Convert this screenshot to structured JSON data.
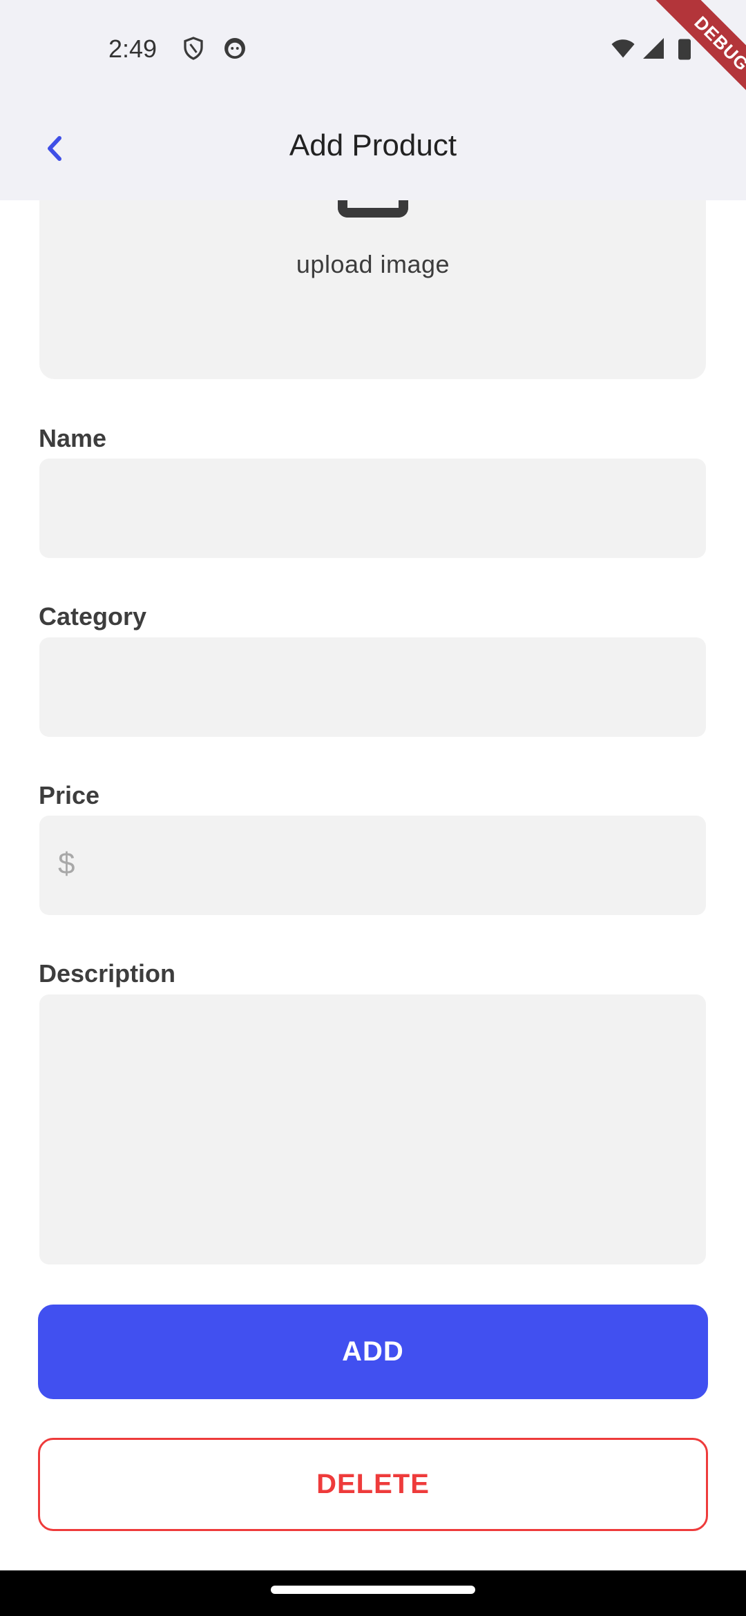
{
  "status_bar": {
    "time": "2:49",
    "icons": [
      "shield-icon",
      "face-icon",
      "wifi-icon",
      "signal-icon",
      "battery-icon"
    ]
  },
  "app_bar": {
    "title": "Add Product",
    "back_icon": "chevron-left-icon"
  },
  "debug_banner": "DEBUG",
  "upload": {
    "label": "upload image",
    "icon": "upload-icon"
  },
  "form": {
    "name": {
      "label": "Name",
      "value": ""
    },
    "category": {
      "label": "Category",
      "value": ""
    },
    "price": {
      "label": "Price",
      "prefix": "$",
      "value": ""
    },
    "description": {
      "label": "Description",
      "value": ""
    }
  },
  "actions": {
    "add_label": "ADD",
    "delete_label": "DELETE"
  },
  "colors": {
    "primary": "#4150f0",
    "danger": "#ee3b3b",
    "field_bg": "#f2f2f2",
    "app_bar_bg": "#f1f1f6"
  }
}
